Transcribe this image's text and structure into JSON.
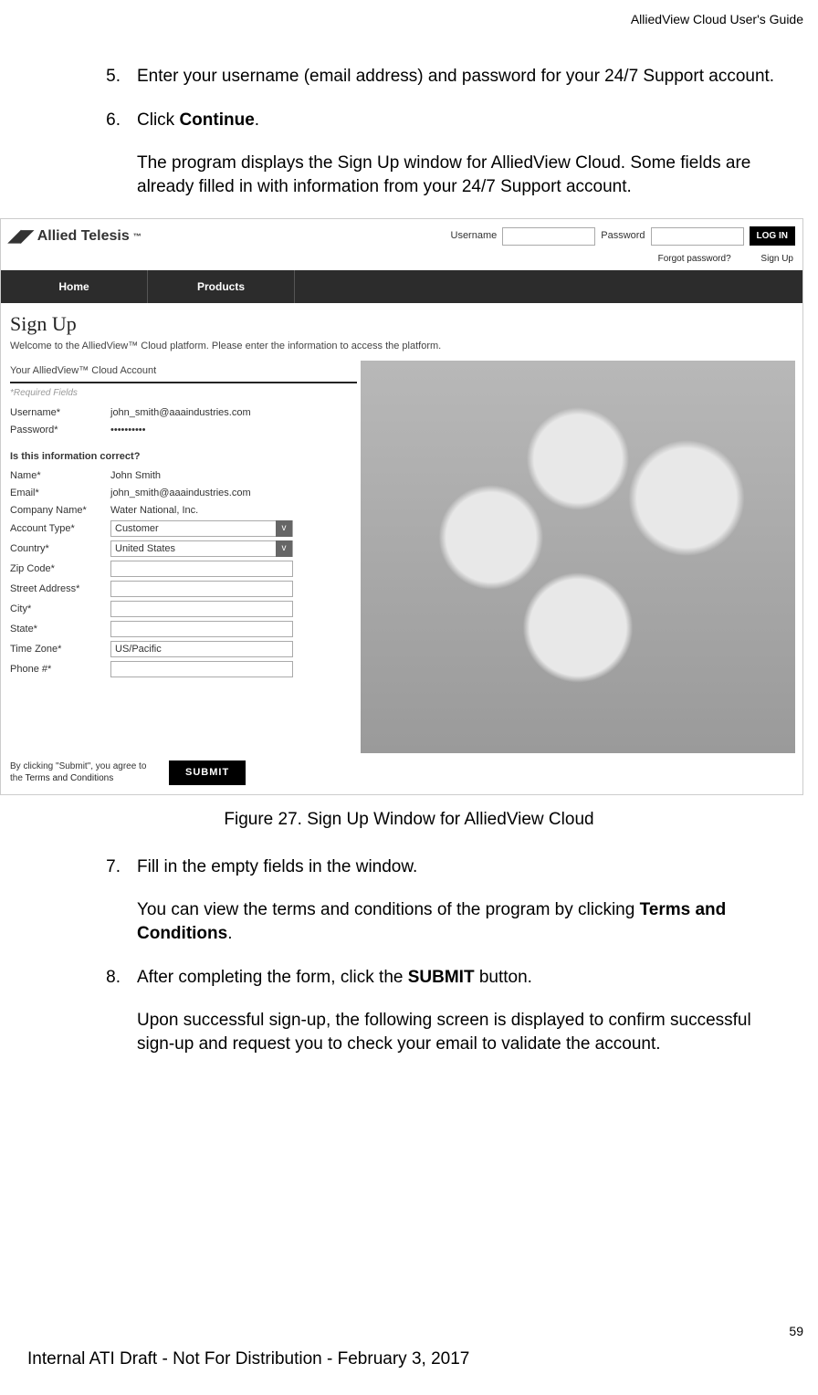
{
  "header": {
    "doc_title": "AlliedView Cloud User's Guide"
  },
  "steps": {
    "s5": {
      "num": "5.",
      "text": "Enter your username (email address) and password for your 24/7 Support account."
    },
    "s6": {
      "num": "6.",
      "line1_a": "Click ",
      "line1_b": "Continue",
      "line1_c": ".",
      "line2": "The program displays the Sign Up window for AlliedView Cloud. Some fields are already filled in with information from your 24/7 Support account."
    },
    "s7": {
      "num": "7.",
      "line1": "Fill in the empty fields in the window.",
      "line2_a": "You can view the terms and conditions of the program by clicking ",
      "line2_b": "Terms and Conditions",
      "line2_c": "."
    },
    "s8": {
      "num": "8.",
      "line1_a": "After completing the form, click the ",
      "line1_b": "SUBMIT",
      "line1_c": " button.",
      "line2": "Upon successful sign-up, the following screen is displayed to confirm successful sign-up and request you to check your email to validate the account."
    }
  },
  "figure": {
    "caption": "Figure 27. Sign Up Window for AlliedView Cloud",
    "logo_text": "Allied Telesis",
    "tm": "™",
    "login": {
      "user_label": "Username",
      "pass_label": "Password",
      "login_btn": "LOG IN",
      "forgot": "Forgot password?",
      "signup": "Sign Up"
    },
    "nav": {
      "home": "Home",
      "products": "Products"
    },
    "signup_title": "Sign Up",
    "welcome": "Welcome to the AlliedView™ Cloud platform. Please enter the information to access the platform.",
    "section1": "Your AlliedView™ Cloud Account",
    "required": "*Required Fields",
    "account": {
      "user_label": "Username*",
      "user_val": "john_smith@aaaindustries.com",
      "pass_label": "Password*",
      "pass_val": "••••••••••"
    },
    "section2": "Is this information correct?",
    "info": {
      "name_l": "Name*",
      "name_v": "John Smith",
      "email_l": "Email*",
      "email_v": "john_smith@aaaindustries.com",
      "company_l": "Company Name*",
      "company_v": "Water National, Inc.",
      "acct_l": "Account Type*",
      "acct_v": "Customer",
      "country_l": "Country*",
      "country_v": "United States",
      "zip_l": "Zip Code*",
      "zip_v": "",
      "street_l": "Street Address*",
      "street_v": "",
      "city_l": "City*",
      "city_v": "",
      "state_l": "State*",
      "state_v": "",
      "tz_l": "Time Zone*",
      "tz_v": "US/Pacific",
      "phone_l": "Phone #*",
      "phone_v": ""
    },
    "terms_a": "By clicking \"Submit\", you agree to the ",
    "terms_b": "Terms and Conditions",
    "submit": "SUBMIT"
  },
  "footer": {
    "page_number": "59",
    "draft_notice": "Internal ATI Draft - Not For Distribution - February 3, 2017"
  }
}
